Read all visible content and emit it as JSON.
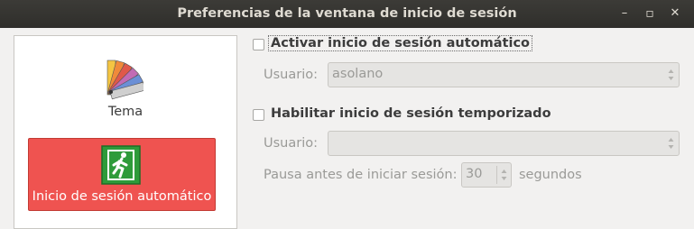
{
  "window": {
    "title": "Preferencias de la ventana de inicio de sesión",
    "minimize_glyph": "–",
    "maximize_glyph": "▫",
    "close_glyph": "✕"
  },
  "sidebar": {
    "items": [
      {
        "label": "Tema",
        "icon": "palette-icon",
        "selected": false
      },
      {
        "label": "Inicio de sesión automático",
        "icon": "exit-icon",
        "selected": true
      }
    ]
  },
  "autologin": {
    "checkbox_label": "Activar inicio de sesión automático",
    "checked": false,
    "user_label": "Usuario:",
    "user_value": "asolano"
  },
  "timed_login": {
    "checkbox_label": "Habilitar inicio de sesión temporizado",
    "checked": false,
    "user_label": "Usuario:",
    "user_value": "",
    "pause_label": "Pausa antes de iniciar sesión:",
    "pause_value": "30",
    "units_label": "segundos"
  },
  "colors": {
    "titlebar": "#3c3b37",
    "selected_item": "#ef5350",
    "window_bg": "#f2f1f0"
  }
}
